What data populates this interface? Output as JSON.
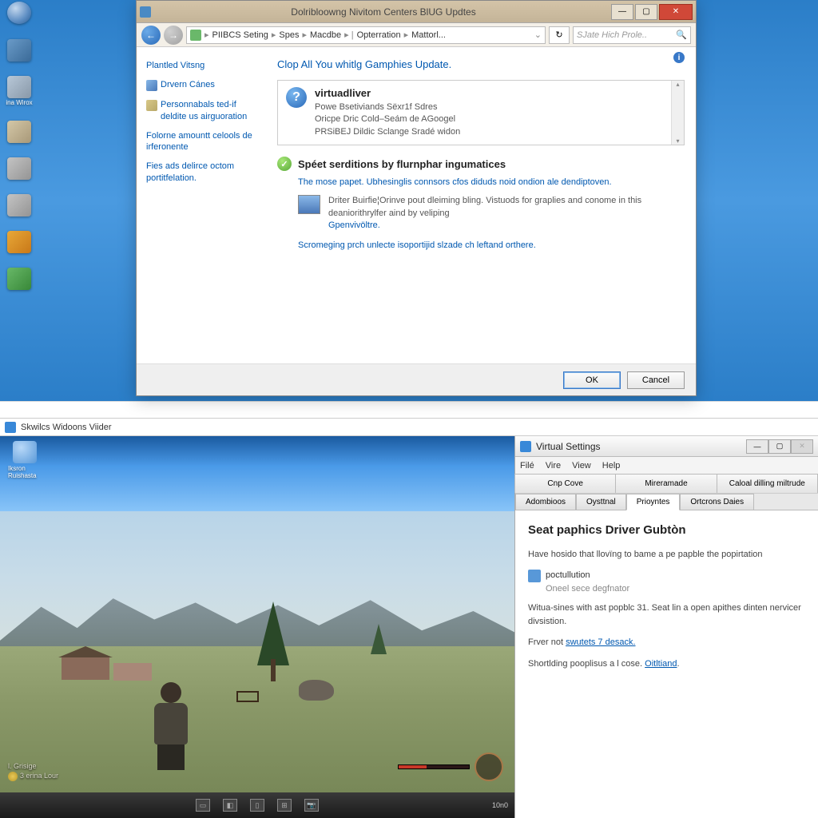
{
  "top": {
    "desktop_icons": {
      "i1": "",
      "i3": "ina Wirox"
    },
    "window": {
      "title": "Dolribloowng Nivitom Centers BlUG Updtes",
      "breadcrumbs": [
        "PIIBCS Seting",
        "Spes",
        "Macdbe",
        "Opterration",
        "Mattorl..."
      ],
      "search_placeholder": "SJate Hich Prole..",
      "sidebar": {
        "l1": "Plantled Vitsng",
        "l2": "Drvern Cánes",
        "l3": "Personnabals ted-if deldite us airguoration",
        "l4": "Folorne amountt celools de irferonente",
        "l5": "Fies ads delirce octom portitfelation."
      },
      "main": {
        "heading": "Clop All You whitlg Gamphies Update.",
        "box_title": "virtuadliver",
        "box_l1": "Powe Bsetiviands Sëxr1f Sdres",
        "box_l2": "Oricpe Dric Cold–Seám de AGoogel",
        "box_l3": "PRSiBEJ Dildic Sclange Sradé widon",
        "sect_title": "Spéet serditions by flurnphar ingumatices",
        "sect_desc": "The mose papet. Ubhesinglis connsors cfos diduds noid ondion ale dendiptoven.",
        "sect_item1": "Driter Buirfie¦Orinve pout dleiming bling. Vistuods for graplies and conome in this deaniorithrylfer aind by veliping",
        "sect_item1_link": "Gpenvivöltre.",
        "sect_footer": "Scromeging prch unlecte isoportijid slzade ch leftand orthere."
      },
      "buttons": {
        "ok": "OK",
        "cancel": "Cancel"
      }
    }
  },
  "vm_title": "Skwilcs Widoons Viider",
  "bottom": {
    "game_icon_label": "Iksron Ruishasta",
    "hud": {
      "l1": "l. Grisige",
      "l2": "3 erina Lour"
    },
    "taskbar_time": "10n0"
  },
  "settings": {
    "title": "Virtual Settings",
    "menu": [
      "Filé",
      "Vire",
      "View",
      "Help"
    ],
    "toolbar": [
      "Cnp Cove",
      "Mireramade",
      "Caloal dilling miltrude"
    ],
    "tabs": [
      "Adombioos",
      "Oysttnal",
      "Prioyntes",
      "Ortcrons Daies"
    ],
    "heading": "Seat paphics Driver Gubtòn",
    "para1": "Have hosido that llovïng to bame a pe papble the popirtation",
    "item1_a": "poctullution",
    "item1_b": "Oneel sece degfnator",
    "para2": "Witua-sines with ast popblc 31. Seat lin a open apithes dinten nervicer divsistion.",
    "para3_a": "Frver not ",
    "para3_b": "swutets 7 desack.",
    "para4_a": "Shortlding pooplisus a l cose. ",
    "para4_b": "Oitltiand"
  }
}
